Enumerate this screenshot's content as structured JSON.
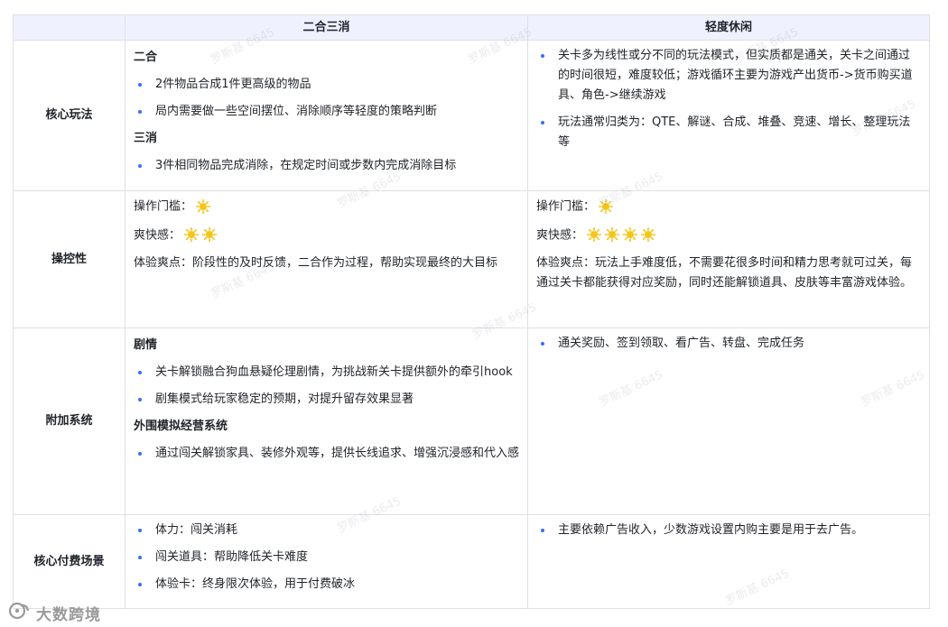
{
  "table": {
    "headers": [
      "",
      "二合三消",
      "轻度休闲"
    ],
    "rows": {
      "core": {
        "label": "核心玩法",
        "left": {
          "h1": "二合",
          "h1_items": [
            "2件物品合成1件更高级的物品",
            "局内需要做一些空间摆位、消除顺序等轻度的策略判断"
          ],
          "h2": "三消",
          "h2_items": [
            "3件相同物品完成消除，在规定时间或步数内完成消除目标"
          ]
        },
        "right": {
          "items": [
            "关卡多为线性或分不同的玩法模式，但实质都是通关，关卡之间通过的时间很短，难度较低；游戏循环主要为游戏产出货币->货币购买道具、角色->继续游戏",
            "玩法通常归类为：QTE、解谜、合成、堆叠、竞速、增长、整理玩法等"
          ]
        }
      },
      "control": {
        "label": "操控性",
        "left": {
          "threshold_label": "操作门槛：",
          "threshold_rating": 1,
          "fun_label": "爽快感：",
          "fun_rating": 2,
          "exp": "体验爽点：阶段性的及时反馈，二合作为过程，帮助实现最终的大目标"
        },
        "right": {
          "threshold_label": "操作门槛：",
          "threshold_rating": 1,
          "fun_label": "爽快感：",
          "fun_rating": 4,
          "exp": "体验爽点：玩法上手难度低，不需要花很多时间和精力思考就可过关，每通过关卡都能获得对应奖励，同时还能解锁道具、皮肤等丰富游戏体验。"
        }
      },
      "extra": {
        "label": "附加系统",
        "left": {
          "h1": "剧情",
          "h1_items": [
            "关卡解锁融合狗血悬疑伦理剧情，为挑战新关卡提供额外的牵引hook",
            "剧集模式给玩家稳定的预期，对提升留存效果显著"
          ],
          "h2": "外围模拟经营系统",
          "h2_items": [
            "通过闯关解锁家具、装修外观等，提供长线追求、增强沉浸感和代入感"
          ]
        },
        "right": {
          "items": [
            "通关奖励、签到领取、看广告、转盘、完成任务"
          ]
        }
      },
      "pay": {
        "label": "核心付费场景",
        "left": {
          "items": [
            "体力：闯关消耗",
            "闯关道具：帮助降低关卡难度",
            "体验卡：终身限次体验，用于付费破冰"
          ]
        },
        "right": {
          "items": [
            "主要依赖广告收入，少数游戏设置内购主要是用于去广告。"
          ]
        }
      }
    }
  },
  "watermark": "罗斯基 6645",
  "logo_text": "大数跨境",
  "icons": {
    "rating": "sun-icon",
    "logo": "logo-icon"
  },
  "colors": {
    "header_bg": "#f0f1fe",
    "border": "#dee0e3",
    "bullet": "#3370ff",
    "sun": "#f5c518"
  }
}
